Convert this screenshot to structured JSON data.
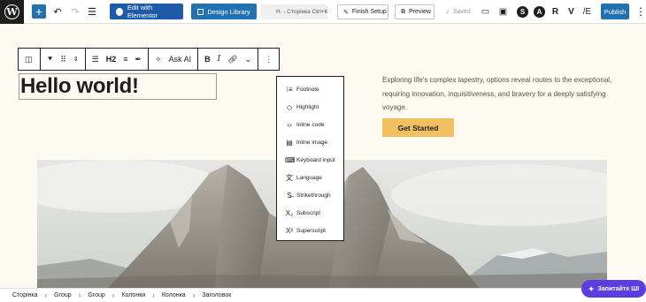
{
  "topbar": {
    "add_icon": "+",
    "undo_icon": "↶",
    "redo_icon": "↷",
    "list_view_icon": "☰",
    "edit_elementor_label": "Edit with Elementor",
    "design_library_label": "Design Library",
    "command_label": "H. - Сторінка Ctrl+K",
    "finish_setup_label": "Finish Setup",
    "preview_label": "Preview",
    "saved_label": "Saved",
    "publish_label": "Publish",
    "plugin_icons": [
      "S",
      "A",
      "R",
      "V",
      "/E"
    ]
  },
  "block_toolbar": {
    "heading_level": "H2",
    "ask_ai_label": "Ask AI",
    "bold": "B",
    "italic": "I"
  },
  "heading": {
    "text": "Hello world!"
  },
  "intro": {
    "text": "Exploring life's complex tapestry, options reveal routes to the exceptional, requiring innovation, inquisitiveness, and bravery for a deeply satisfying voyage.",
    "cta_label": "Get Started"
  },
  "dropdown": {
    "items": [
      {
        "icon": "⁝≡",
        "label": "Footnote"
      },
      {
        "icon": "◇",
        "label": "Highlight"
      },
      {
        "icon": "‹›",
        "label": "Inline code"
      },
      {
        "icon": "▤",
        "label": "Inline image"
      },
      {
        "icon": "⌨",
        "label": "Keyboard input"
      },
      {
        "icon": "文",
        "label": "Language"
      },
      {
        "icon": "S̶",
        "label": "Strikethrough"
      },
      {
        "icon": "X₂",
        "label": "Subscript"
      },
      {
        "icon": "X²",
        "label": "Superscript"
      }
    ]
  },
  "breadcrumb": {
    "items": [
      "Сторінка",
      "Group",
      "Group",
      "Колонки",
      "Колонка",
      "Заголовок"
    ]
  },
  "ai_fab": {
    "label": "Запитайте ШІ"
  },
  "colors": {
    "accent": "#2271b1",
    "cta": "#f2c061",
    "ai_fab": "#5b3ee0",
    "page_bg": "#fdfaf2"
  }
}
